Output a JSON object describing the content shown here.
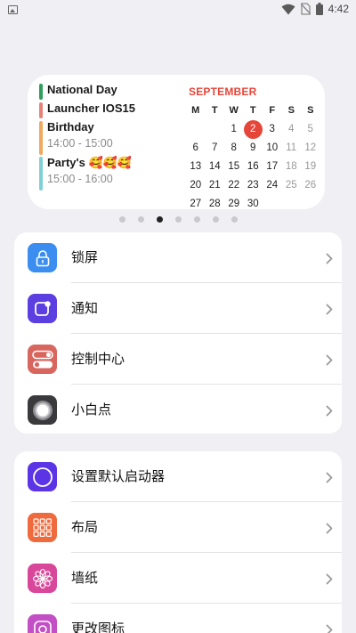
{
  "status_bar": {
    "time": "4:42",
    "icons": [
      "image-icon",
      "wifi-icon",
      "no-sim-icon",
      "battery-icon"
    ]
  },
  "widget": {
    "events": [
      {
        "title": "National Day",
        "time": "",
        "color": "#2e9e5b"
      },
      {
        "title": "Launcher IOS15",
        "time": "",
        "color": "#e88277"
      },
      {
        "title": "Birthday",
        "time": "14:00 - 15:00",
        "color": "#f0a95e"
      },
      {
        "title": "Party's 🥰🥰🥰",
        "time": "15:00 - 16:00",
        "color": "#7fd0d6"
      }
    ],
    "calendar": {
      "month": "SEPTEMBER",
      "weekdays": [
        "M",
        "T",
        "W",
        "T",
        "F",
        "S",
        "S"
      ],
      "weeks": [
        [
          "",
          "",
          "1",
          "2",
          "3",
          "4",
          "5"
        ],
        [
          "6",
          "7",
          "8",
          "9",
          "10",
          "11",
          "12"
        ],
        [
          "13",
          "14",
          "15",
          "16",
          "17",
          "18",
          "19"
        ],
        [
          "20",
          "21",
          "22",
          "23",
          "24",
          "25",
          "26"
        ],
        [
          "27",
          "28",
          "29",
          "30",
          "",
          "",
          ""
        ]
      ],
      "today": "2",
      "accent": "#e5463a"
    }
  },
  "page_dots": {
    "count": 7,
    "active": 2
  },
  "settings": {
    "group1": [
      {
        "name": "lock-screen",
        "label": "锁屏",
        "icon": "lock-icon",
        "color": "#3b8ef0"
      },
      {
        "name": "notifications",
        "label": "通知",
        "icon": "notification-icon",
        "color": "#5b3fe0"
      },
      {
        "name": "control-center",
        "label": "控制中心",
        "icon": "toggle-switches-icon",
        "color": "#d9655f"
      },
      {
        "name": "assistive-touch",
        "label": "小白点",
        "icon": "assistive-touch-icon",
        "color": "#3a3a3c"
      }
    ],
    "group2": [
      {
        "name": "default-launcher",
        "label": "设置默认启动器",
        "icon": "launcher-circle-icon",
        "color": "#5b34e6"
      },
      {
        "name": "layout",
        "label": "布局",
        "icon": "grid-layout-icon",
        "color": "#ef6a3d"
      },
      {
        "name": "wallpaper",
        "label": "墙纸",
        "icon": "flower-icon",
        "color": "#d8479a"
      },
      {
        "name": "change-icons",
        "label": "更改图标",
        "icon": "change-icon-icon",
        "color": "#c34fc5"
      }
    ]
  }
}
